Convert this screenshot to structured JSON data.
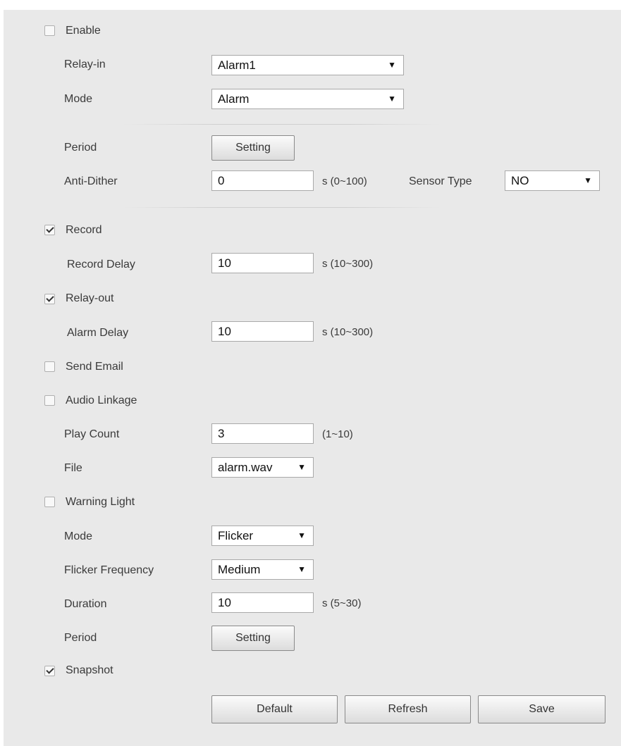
{
  "enable": {
    "label": "Enable",
    "checked": false
  },
  "relay_in": {
    "label": "Relay-in",
    "value": "Alarm1"
  },
  "mode": {
    "label": "Mode",
    "value": "Alarm"
  },
  "period": {
    "label": "Period",
    "button": "Setting"
  },
  "anti_dither": {
    "label": "Anti-Dither",
    "value": "0",
    "unit": "s (0~100)"
  },
  "sensor_type": {
    "label": "Sensor Type",
    "value": "NO"
  },
  "record": {
    "label": "Record",
    "checked": true
  },
  "record_delay": {
    "label": "Record Delay",
    "value": "10",
    "unit": "s (10~300)"
  },
  "relay_out": {
    "label": "Relay-out",
    "checked": true
  },
  "alarm_delay": {
    "label": "Alarm Delay",
    "value": "10",
    "unit": "s (10~300)"
  },
  "send_email": {
    "label": "Send Email",
    "checked": false
  },
  "audio_linkage": {
    "label": "Audio Linkage",
    "checked": false
  },
  "play_count": {
    "label": "Play Count",
    "value": "3",
    "unit": "(1~10)"
  },
  "file": {
    "label": "File",
    "value": "alarm.wav"
  },
  "warning_light": {
    "label": "Warning Light",
    "checked": false
  },
  "light_mode": {
    "label": "Mode",
    "value": "Flicker"
  },
  "flicker_frequency": {
    "label": "Flicker Frequency",
    "value": "Medium"
  },
  "duration": {
    "label": "Duration",
    "value": "10",
    "unit": "s (5~30)"
  },
  "light_period": {
    "label": "Period",
    "button": "Setting"
  },
  "snapshot": {
    "label": "Snapshot",
    "checked": true
  },
  "actions": {
    "default": "Default",
    "refresh": "Refresh",
    "save": "Save"
  },
  "dropdown_arrow": "▼",
  "colors": {
    "panel_bg": "#e9e9e9",
    "field_border": "#a9a9a9"
  }
}
